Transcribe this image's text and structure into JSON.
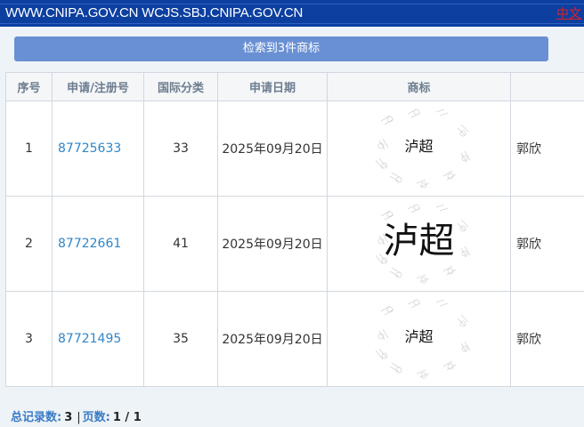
{
  "header": {
    "site_title": "WWW.CNIPA.GOV.CN WCJS.SBJ.CNIPA.GOV.CN",
    "lang_link": "中文",
    "bar_color": "#0c3fa0"
  },
  "result_banner": "检索到3件商标",
  "table": {
    "columns": [
      "序号",
      "申请/注册号",
      "国际分类",
      "申请日期",
      "商标",
      ""
    ],
    "rows": [
      {
        "index": "1",
        "reg_no": "87725633",
        "class": "33",
        "date": "2025年09月20日",
        "mark": "泸超",
        "applicant": "郭欣"
      },
      {
        "index": "2",
        "reg_no": "87722661",
        "class": "41",
        "date": "2025年09月20日",
        "mark": "泸超",
        "applicant": "郭欣"
      },
      {
        "index": "3",
        "reg_no": "87721495",
        "class": "35",
        "date": "2025年09月20日",
        "mark": "泸超",
        "applicant": "郭欣"
      }
    ],
    "watermark_icon": "cnipa-watermark-icon",
    "link_color": "#2f86c8"
  },
  "footer": {
    "total_label": "总记录数:",
    "total_value": "3",
    "separator": "|",
    "pages_label": "页数:",
    "pages_value": "1 / 1"
  }
}
